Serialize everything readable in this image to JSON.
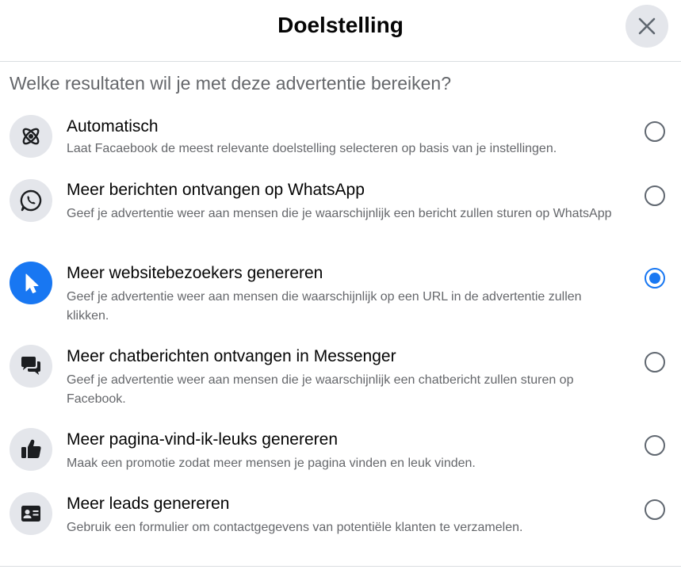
{
  "dialog": {
    "title": "Doelstelling",
    "close_label": "close"
  },
  "question": "Welke resultaten wil je met deze advertentie bereiken?",
  "options": [
    {
      "title": "Automatisch",
      "description": "Laat Facaebook de meest relevante doelstelling selecteren op basis van je instellingen.",
      "icon": "atom-icon",
      "selected": false
    },
    {
      "title": "Meer berichten ontvangen op WhatsApp",
      "description": "Geef je advertentie weer aan mensen die je waarschijnlijk een bericht zullen sturen op WhatsApp",
      "icon": "whatsapp-icon",
      "selected": false
    },
    {
      "title": "Meer websitebezoekers genereren",
      "description": "Geef je advertentie weer aan mensen die waarschijnlijk op een URL in de advertentie zullen klikken.",
      "icon": "cursor-icon",
      "selected": true
    },
    {
      "title": "Meer chatberichten ontvangen in Messenger",
      "description": "Geef je advertentie weer aan mensen die je waarschijnlijk een chatbericht zullen sturen op Facebook.",
      "icon": "chat-bubbles-icon",
      "selected": false
    },
    {
      "title": "Meer pagina-vind-ik-leuks genereren",
      "description": "Maak een promotie zodat meer mensen je pagina vinden en leuk vinden.",
      "icon": "thumbs-up-icon",
      "selected": false
    },
    {
      "title": "Meer leads genereren",
      "description": "Gebruik een formulier om contactgegevens van potentiële klanten te verzamelen.",
      "icon": "contact-card-icon",
      "selected": false
    }
  ],
  "colors": {
    "accent": "#1877f2",
    "icon_bg": "#e4e6eb",
    "secondary_text": "#65676b"
  }
}
